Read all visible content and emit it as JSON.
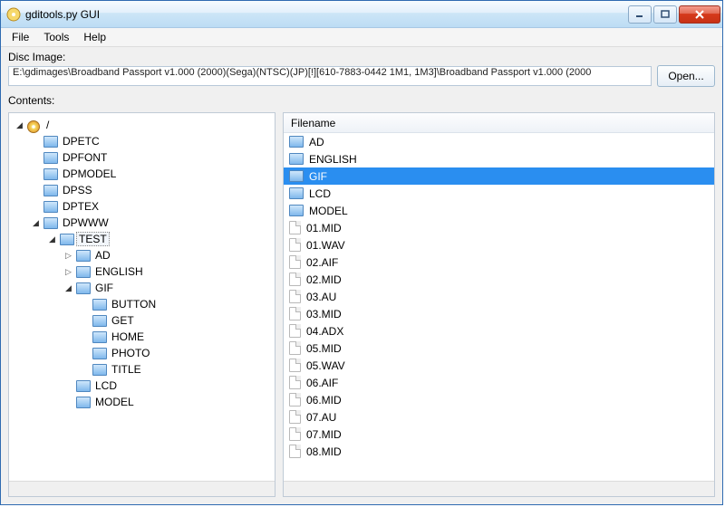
{
  "window": {
    "title": "gditools.py GUI"
  },
  "menubar": [
    "File",
    "Tools",
    "Help"
  ],
  "disc": {
    "label": "Disc Image:",
    "path": "E:\\gdimages\\Broadband Passport v1.000 (2000)(Sega)(NTSC)(JP)[!][610-7883-0442 1M1, 1M3]\\Broadband Passport v1.000 (2000",
    "open_label": "Open..."
  },
  "contents_label": "Contents:",
  "list": {
    "header": "Filename",
    "selected_index": 2,
    "items": [
      {
        "name": "AD",
        "type": "folder"
      },
      {
        "name": "ENGLISH",
        "type": "folder"
      },
      {
        "name": "GIF",
        "type": "folder"
      },
      {
        "name": "LCD",
        "type": "folder"
      },
      {
        "name": "MODEL",
        "type": "folder"
      },
      {
        "name": "01.MID",
        "type": "file"
      },
      {
        "name": "01.WAV",
        "type": "file"
      },
      {
        "name": "02.AIF",
        "type": "file"
      },
      {
        "name": "02.MID",
        "type": "file"
      },
      {
        "name": "03.AU",
        "type": "file"
      },
      {
        "name": "03.MID",
        "type": "file"
      },
      {
        "name": "04.ADX",
        "type": "file"
      },
      {
        "name": "05.MID",
        "type": "file"
      },
      {
        "name": "05.WAV",
        "type": "file"
      },
      {
        "name": "06.AIF",
        "type": "file"
      },
      {
        "name": "06.MID",
        "type": "file"
      },
      {
        "name": "07.AU",
        "type": "file"
      },
      {
        "name": "07.MID",
        "type": "file"
      },
      {
        "name": "08.MID",
        "type": "file"
      }
    ]
  },
  "tree": {
    "root_label": "/",
    "nodes": [
      {
        "depth": 0,
        "twisty": "open",
        "icon": "disc",
        "label": "/",
        "selected": false
      },
      {
        "depth": 1,
        "twisty": "blank",
        "icon": "folder",
        "label": "DPETC"
      },
      {
        "depth": 1,
        "twisty": "blank",
        "icon": "folder",
        "label": "DPFONT"
      },
      {
        "depth": 1,
        "twisty": "blank",
        "icon": "folder",
        "label": "DPMODEL"
      },
      {
        "depth": 1,
        "twisty": "blank",
        "icon": "folder",
        "label": "DPSS"
      },
      {
        "depth": 1,
        "twisty": "blank",
        "icon": "folder",
        "label": "DPTEX"
      },
      {
        "depth": 1,
        "twisty": "open",
        "icon": "folder",
        "label": "DPWWW"
      },
      {
        "depth": 2,
        "twisty": "open",
        "icon": "folder",
        "label": "TEST",
        "selected": true
      },
      {
        "depth": 3,
        "twisty": "closed",
        "icon": "folder",
        "label": "AD"
      },
      {
        "depth": 3,
        "twisty": "closed",
        "icon": "folder",
        "label": "ENGLISH"
      },
      {
        "depth": 3,
        "twisty": "open",
        "icon": "folder",
        "label": "GIF"
      },
      {
        "depth": 4,
        "twisty": "blank",
        "icon": "folder",
        "label": "BUTTON"
      },
      {
        "depth": 4,
        "twisty": "blank",
        "icon": "folder",
        "label": "GET"
      },
      {
        "depth": 4,
        "twisty": "blank",
        "icon": "folder",
        "label": "HOME"
      },
      {
        "depth": 4,
        "twisty": "blank",
        "icon": "folder",
        "label": "PHOTO"
      },
      {
        "depth": 4,
        "twisty": "blank",
        "icon": "folder",
        "label": "TITLE"
      },
      {
        "depth": 3,
        "twisty": "blank",
        "icon": "folder",
        "label": "LCD"
      },
      {
        "depth": 3,
        "twisty": "blank",
        "icon": "folder",
        "label": "MODEL"
      }
    ]
  }
}
